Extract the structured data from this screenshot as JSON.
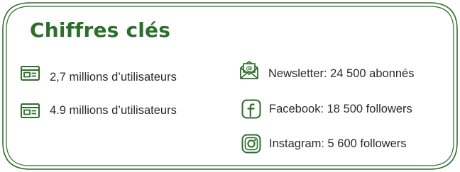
{
  "colors": {
    "accent": "#2e6e2c",
    "border": "#2e6e2c",
    "text": "#2b2b2b",
    "background": "#ffffff"
  },
  "title": "Chiffres clés",
  "left_stats": [
    {
      "icon": "browser-window-icon",
      "text": "2,7 millions d’utilisateurs"
    },
    {
      "icon": "browser-window-icon",
      "text": "4.9 millions d’utilisateurs"
    }
  ],
  "right_stats": [
    {
      "icon": "newsletter-envelope-icon",
      "text": "Newsletter: 24 500 abonnés"
    },
    {
      "icon": "facebook-icon",
      "text": "Facebook: 18 500 followers"
    },
    {
      "icon": "instagram-icon",
      "text": "Instagram: 5 600 followers"
    }
  ]
}
